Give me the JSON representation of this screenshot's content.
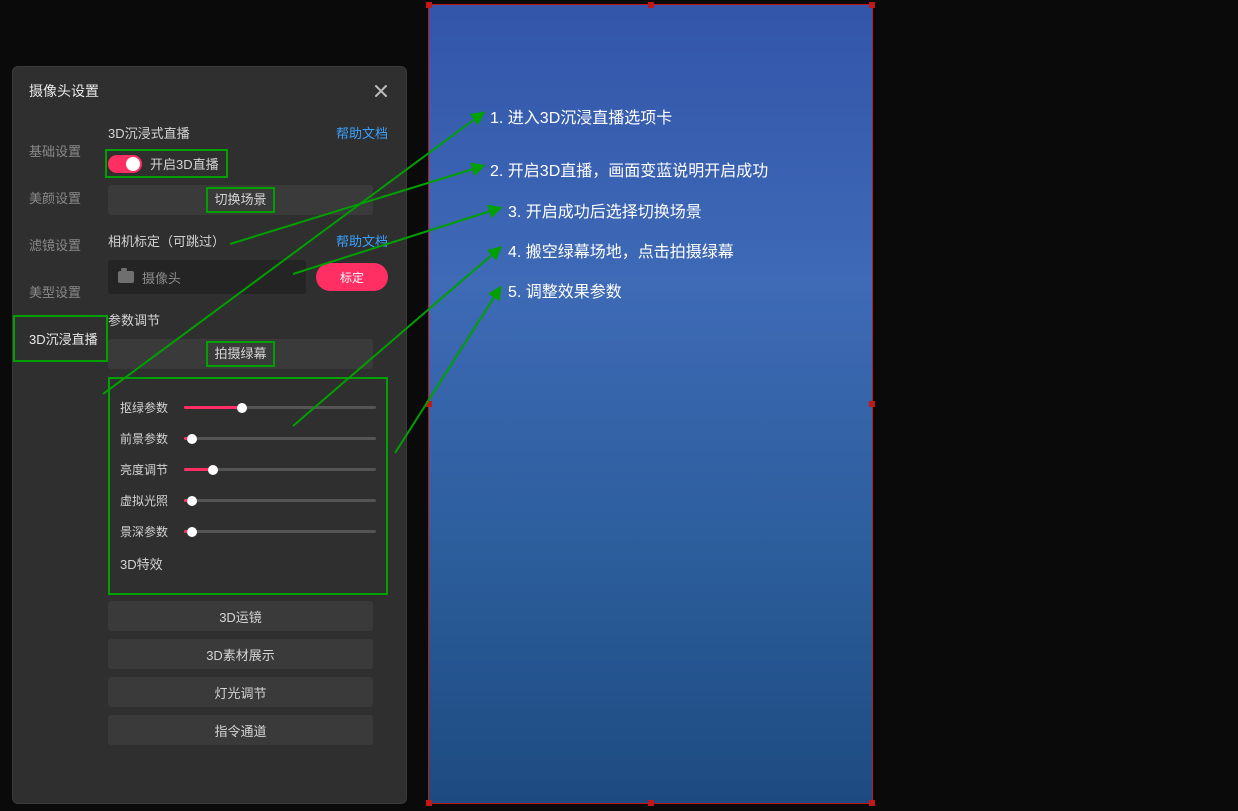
{
  "dialog": {
    "title": "摄像头设置",
    "tabs": [
      "基础设置",
      "美颜设置",
      "滤镜设置",
      "美型设置",
      "3D沉浸直播"
    ],
    "active_tab": 4,
    "help_link": "帮助文档",
    "section_3d_label": "3D沉浸式直播",
    "toggle_label": "开启3D直播",
    "switch_scene_btn": "切换场景",
    "calib_label": "相机标定（可跳过）",
    "camera_placeholder": "摄像头",
    "calib_btn": "标定",
    "param_label": "参数调节",
    "capture_btn": "拍摄绿幕",
    "sliders": [
      {
        "name": "抠绿参数",
        "value": 30
      },
      {
        "name": "前景参数",
        "value": 4
      },
      {
        "name": "亮度调节",
        "value": 15
      },
      {
        "name": "虚拟光照",
        "value": 4
      },
      {
        "name": "景深参数",
        "value": 4
      }
    ],
    "fx_label": "3D特效",
    "fx_buttons": [
      "3D运镜",
      "3D素材展示",
      "灯光调节",
      "指令通道"
    ]
  },
  "annotations": [
    "1. 进入3D沉浸直播选项卡",
    "2. 开启3D直播，画面变蓝说明开启成功",
    "3. 开启成功后选择切换场景",
    "4. 搬空绿幕场地，点击拍摄绿幕",
    "5. 调整效果参数"
  ]
}
